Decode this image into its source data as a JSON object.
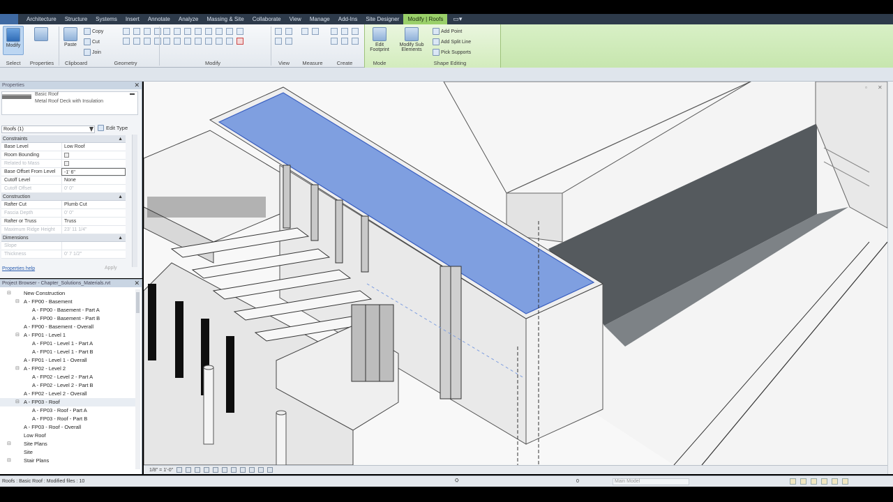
{
  "ribbon": {
    "tabs": [
      "Architecture",
      "Structure",
      "Systems",
      "Insert",
      "Annotate",
      "Analyze",
      "Massing & Site",
      "Collaborate",
      "View",
      "Manage",
      "Add-Ins",
      "Site Designer",
      "Modify | Roofs"
    ],
    "active_tab": "Modify | Roofs",
    "buttons": {
      "modify": "Modify",
      "properties": "Properties",
      "paste": "Paste",
      "copy": "Copy",
      "cut": "Cut",
      "join": "Join",
      "edit_footprint": "Edit Footprint",
      "modify_sub_elements": "Modify Sub Elements",
      "add_point": "Add Point",
      "add_split_line": "Add Split Line",
      "pick_supports": "Pick Supports"
    },
    "panels": {
      "select": "Select",
      "properties": "Properties",
      "clipboard": "Clipboard",
      "geometry": "Geometry",
      "modify": "Modify",
      "view": "View",
      "measure": "Measure",
      "create": "Create",
      "mode": "Mode",
      "shape_editing": "Shape Editing"
    }
  },
  "properties": {
    "title": "Properties",
    "type_family": "Basic Roof",
    "type_name": "Metal Roof Deck with Insulation",
    "instance_filter": "Roofs (1)",
    "edit_type": "Edit Type",
    "sections": {
      "constraints": "Constraints",
      "construction": "Construction",
      "dimensions": "Dimensions"
    },
    "rows": {
      "base_level": {
        "k": "Base Level",
        "v": "Low Roof"
      },
      "room_bounding": {
        "k": "Room Bounding",
        "v": ""
      },
      "related_to_mass": {
        "k": "Related to Mass",
        "v": ""
      },
      "base_offset": {
        "k": "Base Offset From Level",
        "v": "-1' 6\""
      },
      "cutoff_level": {
        "k": "Cutoff Level",
        "v": "None"
      },
      "cutoff_offset": {
        "k": "Cutoff Offset",
        "v": "0' 0\""
      },
      "rafter_cut": {
        "k": "Rafter Cut",
        "v": "Plumb Cut"
      },
      "fascia_depth": {
        "k": "Fascia Depth",
        "v": "0' 0\""
      },
      "rafter_or_truss": {
        "k": "Rafter or Truss",
        "v": "Truss"
      },
      "max_ridge_height": {
        "k": "Maximum Ridge Height",
        "v": "23' 11 1/4\""
      },
      "slope": {
        "k": "Slope",
        "v": ""
      },
      "thickness": {
        "k": "Thickness",
        "v": "0' 7 1/2\""
      }
    },
    "help_link": "Properties help",
    "apply": "Apply"
  },
  "browser": {
    "title": "Project Browser - Chapter_Solutions_Materials.rvt",
    "items": [
      {
        "label": "New Construction",
        "indent": 1,
        "toggle": "⊟"
      },
      {
        "label": "A - FP00 - Basement",
        "indent": 2,
        "toggle": "⊟"
      },
      {
        "label": "A - FP00 - Basement - Part A",
        "indent": 3,
        "toggle": ""
      },
      {
        "label": "A - FP00 - Basement - Part B",
        "indent": 3,
        "toggle": ""
      },
      {
        "label": "A - FP00 - Basement - Overall",
        "indent": 2,
        "toggle": ""
      },
      {
        "label": "A - FP01 - Level 1",
        "indent": 2,
        "toggle": "⊟"
      },
      {
        "label": "A - FP01 - Level 1 - Part A",
        "indent": 3,
        "toggle": ""
      },
      {
        "label": "A - FP01 - Level 1 - Part B",
        "indent": 3,
        "toggle": ""
      },
      {
        "label": "A - FP01 - Level 1 - Overall",
        "indent": 2,
        "toggle": ""
      },
      {
        "label": "A - FP02 - Level 2",
        "indent": 2,
        "toggle": "⊟"
      },
      {
        "label": "A - FP02 - Level 2 - Part A",
        "indent": 3,
        "toggle": ""
      },
      {
        "label": "A - FP02 - Level 2 - Part B",
        "indent": 3,
        "toggle": ""
      },
      {
        "label": "A - FP02 - Level 2 - Overall",
        "indent": 2,
        "toggle": ""
      },
      {
        "label": "A - FP03 - Roof",
        "indent": 2,
        "toggle": "⊟"
      },
      {
        "label": "A - FP03 - Roof - Part A",
        "indent": 3,
        "toggle": ""
      },
      {
        "label": "A - FP03 - Roof - Part B",
        "indent": 3,
        "toggle": ""
      },
      {
        "label": "A - FP03 - Roof - Overall",
        "indent": 2,
        "toggle": ""
      },
      {
        "label": "Low Roof",
        "indent": 2,
        "toggle": ""
      },
      {
        "label": "Site Plans",
        "indent": 1,
        "toggle": "⊟"
      },
      {
        "label": "Site",
        "indent": 2,
        "toggle": ""
      },
      {
        "label": "Stair Plans",
        "indent": 1,
        "toggle": "⊟"
      }
    ]
  },
  "view_controls": {
    "scale": "1/8\" = 1'-0\""
  },
  "status": {
    "text": "Roofs : Basic Roof : Modified files : 10",
    "selection_count": "0",
    "model": "Main Model"
  },
  "colors": {
    "ribbon_tabbar": "#2d3a4a",
    "context_tab": "#9ad06a",
    "roof_selection": "#7f9fe0"
  }
}
